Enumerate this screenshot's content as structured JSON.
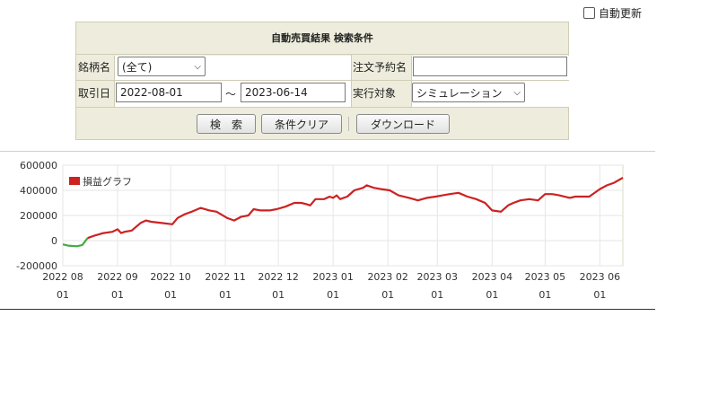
{
  "auto_refresh": {
    "label": "自動更新",
    "checked": false
  },
  "form": {
    "title": "自動売買結果 検索条件",
    "symbol_label": "銘柄名",
    "symbol_value": "(全て)",
    "order_label": "注文予約名",
    "order_value": "",
    "date_label": "取引日",
    "date_from": "2022-08-01",
    "date_separator": "～",
    "date_to": "2023-06-14",
    "target_label": "実行対象",
    "target_value": "シミュレーション"
  },
  "buttons": {
    "search": "検　索",
    "clear": "条件クリア",
    "download": "ダウンロード"
  },
  "chart_data": {
    "type": "line",
    "legend": "損益グラフ",
    "legend_color": "#cc2222",
    "ylim": [
      -200000,
      600000
    ],
    "yticks": [
      600000,
      400000,
      200000,
      0,
      -200000
    ],
    "ytick_labels": [
      "600000",
      "400000",
      "200000",
      "0",
      "-200000"
    ],
    "xtick_labels": [
      [
        "2022 08",
        "01"
      ],
      [
        "2022 09",
        "01"
      ],
      [
        "2022 10",
        "01"
      ],
      [
        "2022 11",
        "01"
      ],
      [
        "2022 12",
        "01"
      ],
      [
        "2023 01",
        "01"
      ],
      [
        "2023 02",
        "01"
      ],
      [
        "2023 03",
        "01"
      ],
      [
        "2023 04",
        "01"
      ],
      [
        "2023 05",
        "01"
      ],
      [
        "2023 06",
        "01"
      ]
    ],
    "xticks": [
      "2022-08-01",
      "2022-09-01",
      "2022-10-01",
      "2022-11-01",
      "2022-12-01",
      "2023-01-01",
      "2023-02-01",
      "2023-03-01",
      "2023-04-01",
      "2023-05-01",
      "2023-06-01"
    ],
    "xlim": [
      "2022-08-01",
      "2023-06-14"
    ],
    "grid": true,
    "negative_color": "#44aa44",
    "positive_color": "#cc2222",
    "series": [
      {
        "x": [
          "2022-08-01",
          "2022-08-04",
          "2022-08-09",
          "2022-08-12",
          "2022-08-15",
          "2022-08-19",
          "2022-08-24",
          "2022-08-29",
          "2022-09-01",
          "2022-09-03",
          "2022-09-05",
          "2022-09-09",
          "2022-09-14",
          "2022-09-17",
          "2022-09-20",
          "2022-09-26",
          "2022-10-02",
          "2022-10-05",
          "2022-10-09",
          "2022-10-13",
          "2022-10-18",
          "2022-10-23",
          "2022-10-27",
          "2022-11-02",
          "2022-11-06",
          "2022-11-10",
          "2022-11-14",
          "2022-11-17",
          "2022-11-21",
          "2022-11-26",
          "2022-11-30",
          "2022-12-05",
          "2022-12-10",
          "2022-12-14",
          "2022-12-17",
          "2022-12-19",
          "2022-12-22",
          "2022-12-27",
          "2022-12-30",
          "2023-01-01",
          "2023-01-03",
          "2023-01-05",
          "2023-01-09",
          "2023-01-13",
          "2023-01-18",
          "2023-01-20",
          "2023-01-24",
          "2023-01-28",
          "2023-02-02",
          "2023-02-07",
          "2023-02-13",
          "2023-02-18",
          "2023-02-23",
          "2023-02-28",
          "2023-03-04",
          "2023-03-08",
          "2023-03-13",
          "2023-03-18",
          "2023-03-23",
          "2023-03-28",
          "2023-04-01",
          "2023-04-06",
          "2023-04-10",
          "2023-04-13",
          "2023-04-17",
          "2023-04-22",
          "2023-04-27",
          "2023-05-01",
          "2023-05-05",
          "2023-05-09",
          "2023-05-15",
          "2023-05-18",
          "2023-05-22",
          "2023-05-26",
          "2023-05-30",
          "2023-06-01",
          "2023-06-05",
          "2023-06-09",
          "2023-06-14"
        ],
        "y": [
          -30000,
          -40000,
          -45000,
          -35000,
          20000,
          40000,
          60000,
          70000,
          90000,
          60000,
          70000,
          80000,
          140000,
          160000,
          150000,
          140000,
          130000,
          180000,
          210000,
          230000,
          260000,
          240000,
          230000,
          180000,
          160000,
          190000,
          200000,
          250000,
          240000,
          240000,
          250000,
          270000,
          300000,
          300000,
          290000,
          280000,
          330000,
          330000,
          350000,
          340000,
          360000,
          330000,
          350000,
          400000,
          420000,
          440000,
          420000,
          410000,
          400000,
          360000,
          340000,
          320000,
          340000,
          350000,
          360000,
          370000,
          380000,
          350000,
          330000,
          300000,
          240000,
          230000,
          280000,
          300000,
          320000,
          330000,
          320000,
          370000,
          370000,
          360000,
          340000,
          350000,
          350000,
          350000,
          390000,
          410000,
          440000,
          460000,
          500000
        ]
      }
    ]
  }
}
